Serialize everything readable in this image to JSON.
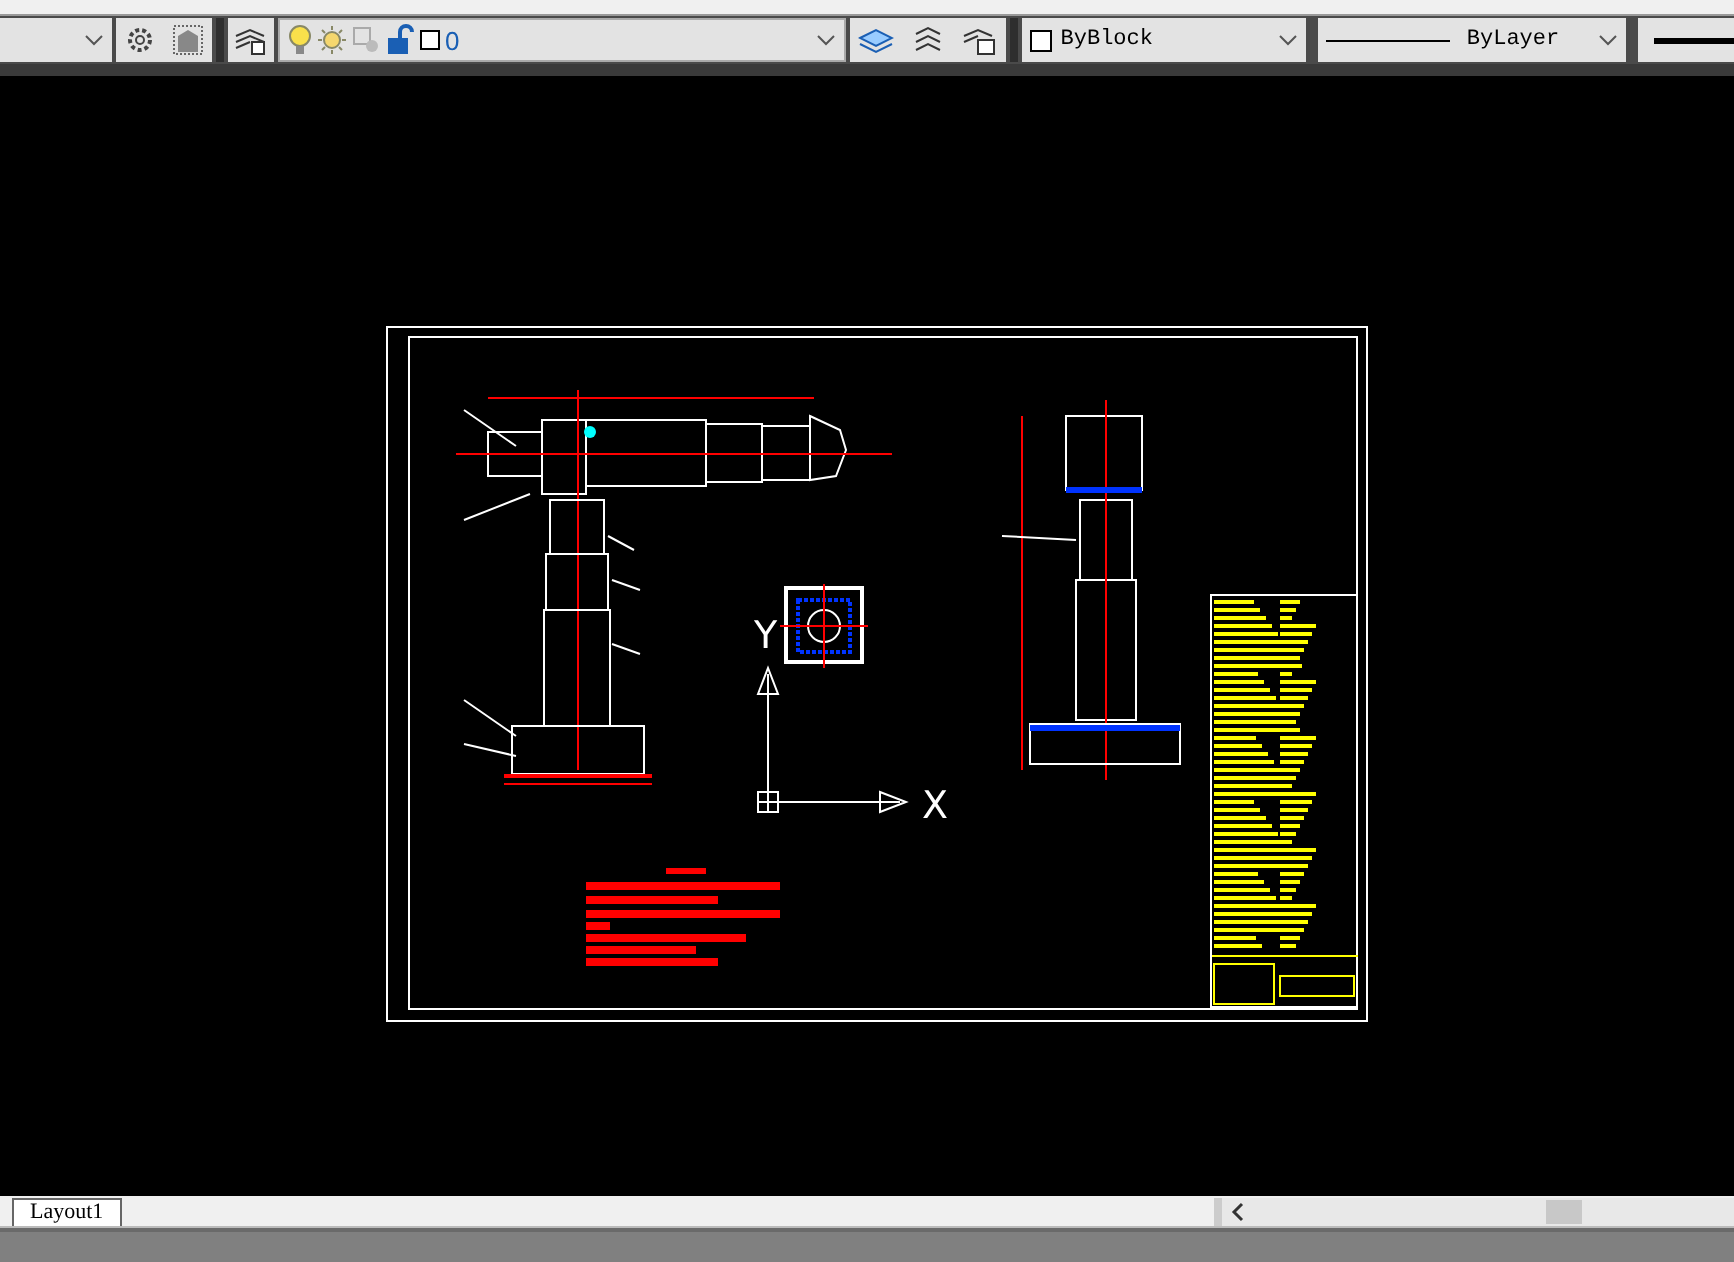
{
  "layer_toolbar": {
    "layer": {
      "name": "0",
      "on": true,
      "locked": false
    }
  },
  "properties_toolbar": {
    "color_setting": "ByBlock",
    "linetype": "ByLayer"
  },
  "drawing": {
    "ucs_labels": {
      "x": "X",
      "y": "Y"
    }
  },
  "layout_tabs": [
    {
      "label": "Layout1",
      "selected": true
    }
  ]
}
